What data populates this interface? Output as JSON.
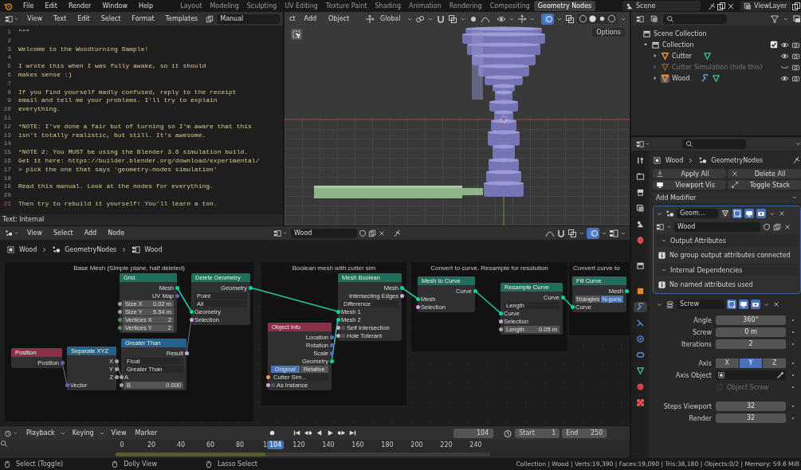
{
  "topbar": {
    "menus": [
      "File",
      "Edit",
      "Render",
      "Window",
      "Help"
    ],
    "workspaces": [
      {
        "label": "Layout",
        "selected": false
      },
      {
        "label": "Modeling",
        "selected": false
      },
      {
        "label": "Sculpting",
        "selected": false
      },
      {
        "label": "UV Editing",
        "selected": false
      },
      {
        "label": "Texture Paint",
        "selected": false
      },
      {
        "label": "Shading",
        "selected": false
      },
      {
        "label": "Animation",
        "selected": false
      },
      {
        "label": "Rendering",
        "selected": false
      },
      {
        "label": "Compositing",
        "selected": false
      },
      {
        "label": "Geometry Nodes",
        "selected": true
      }
    ],
    "scene": "Scene",
    "view_layer": "ViewLayer"
  },
  "text_editor": {
    "menus": [
      "View",
      "Text",
      "Edit",
      "Select",
      "Format",
      "Templates"
    ],
    "file_name": "Manual",
    "lines": [
      {
        "number": "1",
        "text": "\"\"\"",
        "current": false
      },
      {
        "number": "2",
        "current": false
      },
      {
        "number": "3",
        "text": "Welcome to the Woodturning Sample!",
        "current": false
      },
      {
        "number": "4",
        "current": false
      },
      {
        "number": "5",
        "text": "I wrote this when I was fully awake, so it should",
        "current": false
      },
      {
        "number": "6",
        "text": "makes sense :)",
        "current": false
      },
      {
        "number": "7",
        "current": false
      },
      {
        "number": "8",
        "text": "If you find yourself madly confused, reply to the receipt",
        "current": false
      },
      {
        "number": "9",
        "text": "email and tell me your problems. I'll try to explain",
        "current": false
      },
      {
        "number": "10",
        "text": "everything.",
        "current": false
      },
      {
        "number": "11",
        "current": false
      },
      {
        "number": "12",
        "text": "*NOTE: I've done a fair but of turning so I'm aware that this",
        "current": false
      },
      {
        "number": "13",
        "text": "isn't totally realistic, but still. It's awesome.",
        "current": false
      },
      {
        "number": "14",
        "current": false
      },
      {
        "number": "15",
        "text": "*NOTE 2: You MUST be using the Blender 3.6 simulation build.",
        "current": false
      },
      {
        "number": "16",
        "text": "Get it here: https://builder.blender.org/download/experimental/",
        "current": false
      },
      {
        "number": "17",
        "text": "> pick the one that says 'geometry-nodes simulation'",
        "current": false
      },
      {
        "number": "18",
        "current": false
      },
      {
        "number": "19",
        "text": "Read this manual. Look at the nodes for everything.",
        "current": false
      },
      {
        "number": "20",
        "current": false
      },
      {
        "number": "21",
        "text": "Then try to rebuild it yourself! You'll learn a ton.",
        "current": true
      }
    ],
    "footer": "Text: Internal"
  },
  "viewport": {
    "cut_menu": "ct",
    "menus": [
      "Add",
      "Object"
    ],
    "orientation": "Global",
    "options": "Options"
  },
  "outliner": {
    "scene_collection": "Scene Collection",
    "collection": {
      "label": "Collection",
      "expanded": true,
      "checked": true
    },
    "objects": [
      {
        "label": "Cutter",
        "hidden": false,
        "active": false,
        "modifier": false,
        "mesh_data": true
      },
      {
        "label": "Cutter Simulation (hide this)",
        "hidden": true,
        "active": false,
        "modifier": false,
        "mesh_data": false
      },
      {
        "label": "Wood",
        "hidden": false,
        "active": true,
        "modifier": true,
        "mesh_data": true
      }
    ]
  },
  "properties": {
    "tabs": [
      {
        "kind": "tool",
        "selected": false
      },
      {
        "kind": "render",
        "selected": false
      },
      {
        "kind": "output",
        "selected": false
      },
      {
        "kind": "view_layer",
        "selected": false
      },
      {
        "kind": "scene",
        "selected": false
      },
      {
        "kind": "world",
        "selected": false
      },
      {
        "kind": "collection",
        "selected": false
      },
      {
        "kind": "object",
        "selected": false
      },
      {
        "kind": "modifiers",
        "selected": true
      },
      {
        "kind": "particles",
        "selected": false
      },
      {
        "kind": "physics",
        "selected": false
      },
      {
        "kind": "constraints",
        "selected": false
      },
      {
        "kind": "data",
        "selected": false
      },
      {
        "kind": "material",
        "selected": false
      },
      {
        "kind": "texture",
        "selected": false
      }
    ],
    "breadcrumb": [
      "Wood",
      "GeometryNodes"
    ],
    "buttons": [
      "Apply All",
      "Delete All",
      "Viewport Vis",
      "Toggle Stack"
    ],
    "add_modifier": "Add Modifier",
    "geometry_nodes": {
      "name": "Geom...",
      "expanded": true,
      "toggles": [
        {
          "kind": "cage",
          "on": false
        },
        {
          "kind": "editmode",
          "on": true
        },
        {
          "kind": "viewport",
          "on": true
        },
        {
          "kind": "render",
          "on": true
        }
      ],
      "node_group": "Wood",
      "sections": [
        {
          "title": "Output Attributes",
          "expanded": true,
          "message": "No group output attributes connected"
        },
        {
          "title": "Internal Dependencies",
          "expanded": true,
          "message": "No named attributes used"
        }
      ]
    },
    "screw": {
      "name": "Screw",
      "expanded": true,
      "toggles": [
        {
          "kind": "editmode",
          "on": true
        },
        {
          "kind": "viewport",
          "on": true
        },
        {
          "kind": "render",
          "on": true
        }
      ],
      "fields": [
        {
          "label": "Angle",
          "value": "360°"
        },
        {
          "label": "Screw",
          "value": "0 m"
        },
        {
          "label": "Iterations",
          "value": "2"
        }
      ],
      "axis": {
        "label": "Axis",
        "options": [
          {
            "label": "X",
            "selected": false
          },
          {
            "label": "Y",
            "selected": true
          },
          {
            "label": "Z",
            "selected": false
          }
        ]
      },
      "axis_object": {
        "label": "Axis Object"
      },
      "object_screw": {
        "label": "Object Screw",
        "checked": false,
        "disabled": true
      },
      "steps": [
        {
          "label": "Steps Viewport",
          "value": "32"
        },
        {
          "label": "Render",
          "value": "32"
        }
      ]
    }
  },
  "node_editor": {
    "menus": [
      "View",
      "Select",
      "Add",
      "Node"
    ],
    "node_group": "Wood",
    "breadcrumb": [
      "Wood",
      "GeometryNodes",
      "Wood"
    ],
    "frames": [
      {
        "label": "Base Mesh (Simple plane, half deleted)"
      },
      {
        "label": "Boolean mesh with cutter sim"
      },
      {
        "label": "Convert to curve. Resample for resolution"
      },
      {
        "label": "Convert curve to"
      }
    ],
    "nodes": [
      {
        "title": "Grid",
        "kind": "geometry",
        "rows": [
          {
            "kind": "out",
            "label": "Mesh",
            "color": "#00d6a3"
          },
          {
            "kind": "out",
            "label": "UV Map",
            "color": "#6363c7"
          },
          {
            "kind": "field",
            "label": "Size X",
            "value": "0.02 m",
            "color": "#a1a1a1"
          },
          {
            "kind": "field",
            "label": "Size Y",
            "value": "5.54 m",
            "color": "#a1a1a1"
          },
          {
            "kind": "field",
            "label": "Vertices X",
            "value": "2",
            "color": "#598c5c"
          },
          {
            "kind": "field",
            "label": "Vertices Y",
            "value": "2",
            "color": "#598c5c"
          }
        ]
      },
      {
        "title": "Delete Geometry",
        "kind": "geometry",
        "rows": [
          {
            "kind": "out",
            "label": "Geometry",
            "color": "#00d6a3"
          },
          {
            "kind": "dropdown",
            "value": "Point"
          },
          {
            "kind": "dropdown",
            "value": "All"
          },
          {
            "kind": "in",
            "label": "Geometry",
            "color": "#00d6a3"
          },
          {
            "kind": "in",
            "label": "Selection",
            "color": "#cca6d6"
          }
        ]
      },
      {
        "title": "Position",
        "kind": "input",
        "rows": [
          {
            "kind": "out",
            "label": "Position",
            "color": "#6363c7"
          }
        ]
      },
      {
        "title": "Separate XYZ",
        "kind": "converter",
        "rows": [
          {
            "kind": "out",
            "label": "X",
            "color": "#a1a1a1"
          },
          {
            "kind": "out",
            "label": "Y",
            "color": "#a1a1a1"
          },
          {
            "kind": "out",
            "label": "Z",
            "color": "#a1a1a1"
          },
          {
            "kind": "in",
            "label": "Vector",
            "color": "#6363c7"
          }
        ]
      },
      {
        "title": "Greater Than",
        "kind": "converter",
        "rows": [
          {
            "kind": "out",
            "label": "Result",
            "color": "#cca6d6"
          },
          {
            "kind": "dropdown",
            "value": "Float"
          },
          {
            "kind": "dropdown",
            "value": "Greater Than"
          },
          {
            "kind": "in",
            "label": "A",
            "color": "#a1a1a1"
          },
          {
            "kind": "field",
            "label": "B",
            "value": "0.000",
            "color": "#a1a1a1"
          }
        ]
      },
      {
        "title": "Mesh Boolean",
        "kind": "geometry",
        "rows": [
          {
            "kind": "out",
            "label": "Mesh",
            "color": "#00d6a3"
          },
          {
            "kind": "out",
            "label": "Intersecting Edges",
            "color": "#cca6d6"
          },
          {
            "kind": "dropdown",
            "value": "Difference"
          },
          {
            "kind": "in",
            "label": "Mesh 1",
            "color": "#00d6a3"
          },
          {
            "kind": "in",
            "label": "Mesh 2",
            "color": "#00d6a3"
          },
          {
            "kind": "check",
            "label": "Self Intersection",
            "checked": false,
            "color": "#cca6d6"
          },
          {
            "kind": "check",
            "label": "Hole Tolerant",
            "checked": false,
            "color": "#cca6d6"
          }
        ]
      },
      {
        "title": "Object Info",
        "kind": "input",
        "rows": [
          {
            "kind": "out",
            "label": "Location",
            "color": "#6363c7"
          },
          {
            "kind": "out",
            "label": "Rotation",
            "color": "#6363c7"
          },
          {
            "kind": "out",
            "label": "Scale",
            "color": "#6363c7"
          },
          {
            "kind": "out",
            "label": "Geometry",
            "color": "#00d6a3"
          },
          {
            "kind": "toggle",
            "options": [
              {
                "label": "Original",
                "selected": true
              },
              {
                "label": "Relative",
                "selected": false
              }
            ]
          },
          {
            "kind": "object",
            "value": "Cutter Sim...",
            "color": "#ed9e5c"
          },
          {
            "kind": "check",
            "label": "As Instance",
            "checked": false,
            "color": "#cca6d6"
          }
        ]
      },
      {
        "title": "Mesh to Curve",
        "kind": "geometry",
        "rows": [
          {
            "kind": "out",
            "label": "Curve",
            "color": "#00d6a3"
          },
          {
            "kind": "in",
            "label": "Mesh",
            "color": "#00d6a3"
          },
          {
            "kind": "in",
            "label": "Selection",
            "color": "#cca6d6"
          }
        ]
      },
      {
        "title": "Resample Curve",
        "kind": "geometry",
        "rows": [
          {
            "kind": "out",
            "label": "Curve",
            "color": "#00d6a3"
          },
          {
            "kind": "dropdown",
            "value": "Length"
          },
          {
            "kind": "in",
            "label": "Curve",
            "color": "#00d6a3"
          },
          {
            "kind": "in",
            "label": "Selection",
            "color": "#cca6d6"
          },
          {
            "kind": "field",
            "label": "Length",
            "value": "0.05 m",
            "color": "#a1a1a1"
          }
        ]
      },
      {
        "title": "Fill Curve",
        "kind": "geometry",
        "rows": [
          {
            "kind": "out",
            "label": "Mesh",
            "color": "#00d6a3"
          },
          {
            "kind": "toggle",
            "options": [
              {
                "label": "Triangles",
                "selected": false
              },
              {
                "label": "N-gons",
                "selected": true
              }
            ]
          },
          {
            "kind": "in",
            "label": "Curve",
            "color": "#00d6a3"
          }
        ]
      }
    ]
  },
  "timeline": {
    "menus": [
      {
        "label": "Playback",
        "dropdown": true
      },
      {
        "label": "Keying",
        "dropdown": true
      },
      {
        "label": "View",
        "dropdown": false
      },
      {
        "label": "Marker",
        "dropdown": false
      }
    ],
    "current_frame": "104",
    "start_label": "Start",
    "start": "1",
    "end_label": "End",
    "end": "250",
    "ticks": [
      "0",
      "20",
      "40",
      "60",
      "80",
      "1",
      "120",
      "140",
      "160",
      "180",
      "200",
      "220",
      "240"
    ],
    "marker": "104",
    "range": {
      "level": 0.4
    }
  },
  "status_bar": {
    "items": [
      {
        "label": "Select (Toggle)"
      },
      {
        "label": "Dolly View"
      },
      {
        "label": "Lasso Select"
      }
    ],
    "stats": "Collection | Wood | Verts:19,390 | Faces:19,090 | Tris:38,180 | Objects:0/2 | Memory: 59.6 MiB"
  }
}
